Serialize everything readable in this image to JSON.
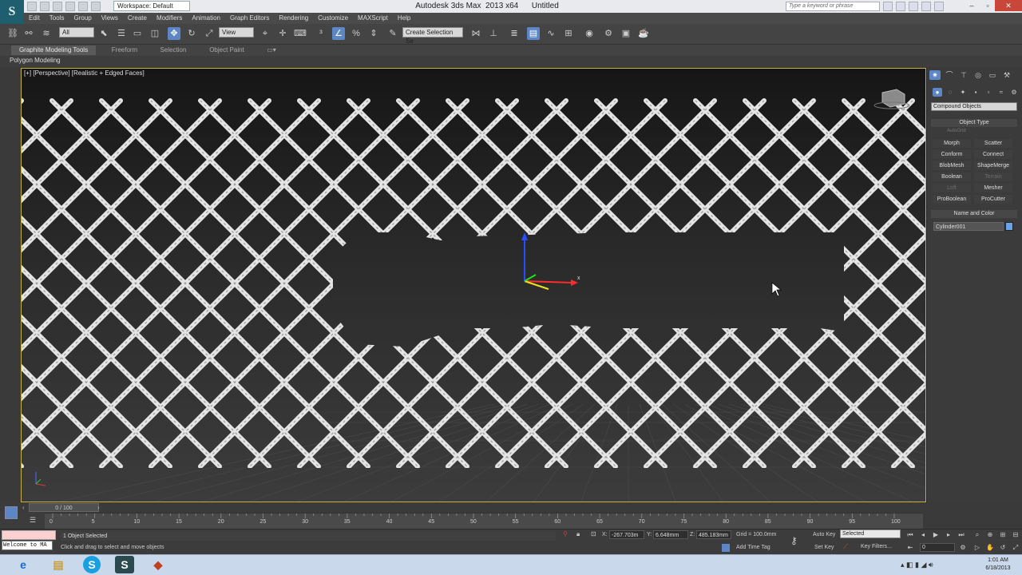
{
  "window": {
    "title": "Autodesk 3ds Max  2013 x64      Untitled",
    "workspace": "Workspace: Default",
    "search_placeholder": "Type a keyword or phrase"
  },
  "menu": [
    "Edit",
    "Tools",
    "Group",
    "Views",
    "Create",
    "Modifiers",
    "Animation",
    "Graph Editors",
    "Rendering",
    "Customize",
    "MAXScript",
    "Help"
  ],
  "toolbar": {
    "selection_filter": "All",
    "ref_coord": "View",
    "named_selection": "Create Selection Se"
  },
  "ribbon": {
    "tabs": [
      "Graphite Modeling Tools",
      "Freeform",
      "Selection",
      "Object Paint"
    ],
    "active_tab": "Graphite Modeling Tools",
    "panel": "Polygon Modeling"
  },
  "viewport": {
    "label": "[+] [Perspective] [Realistic + Edged Faces]",
    "gizmo_axis_x": "x"
  },
  "command_panel": {
    "category": "Compound Objects",
    "object_type_title": "Object Type",
    "autogrid": "AutoGrid",
    "buttons": [
      {
        "label": "Morph",
        "enabled": true
      },
      {
        "label": "Scatter",
        "enabled": true
      },
      {
        "label": "Conform",
        "enabled": true
      },
      {
        "label": "Connect",
        "enabled": true
      },
      {
        "label": "BlobMesh",
        "enabled": true
      },
      {
        "label": "ShapeMerge",
        "enabled": true
      },
      {
        "label": "Boolean",
        "enabled": true
      },
      {
        "label": "Terrain",
        "enabled": false
      },
      {
        "label": "Loft",
        "enabled": false
      },
      {
        "label": "Mesher",
        "enabled": true
      },
      {
        "label": "ProBoolean",
        "enabled": true
      },
      {
        "label": "ProCutter",
        "enabled": true
      }
    ],
    "name_color_title": "Name and Color",
    "object_name": "Cylinder001",
    "object_color": "#6aa3e8"
  },
  "timeline": {
    "frame_readout": "0 / 100",
    "ticks": [
      "0",
      "5",
      "10",
      "15",
      "20",
      "25",
      "30",
      "35",
      "40",
      "45",
      "50",
      "55",
      "60",
      "65",
      "70",
      "75",
      "80",
      "85",
      "90",
      "95",
      "100"
    ]
  },
  "status": {
    "maxscript_text": "Welcome to MA",
    "selection": "1 Object Selected",
    "prompt": "Click and drag to select and move objects",
    "x_label": "X:",
    "x_value": "-267.703m",
    "y_label": "Y:",
    "y_value": "6.648mm",
    "z_label": "Z:",
    "z_value": "485.183mm",
    "grid": "Grid = 100.0mm",
    "add_time_tag": "Add Time Tag",
    "auto_key": "Auto Key",
    "set_key": "Set Key",
    "key_mode": "Selected",
    "key_filters": "Key Filters...",
    "frame": "0"
  },
  "taskbar": {
    "time": "1:01 AM",
    "date": "6/18/2013"
  },
  "colors": {
    "viewport_border": "#c8b040",
    "active_blue": "#5c86c4",
    "fence": "#e4e4e4"
  }
}
